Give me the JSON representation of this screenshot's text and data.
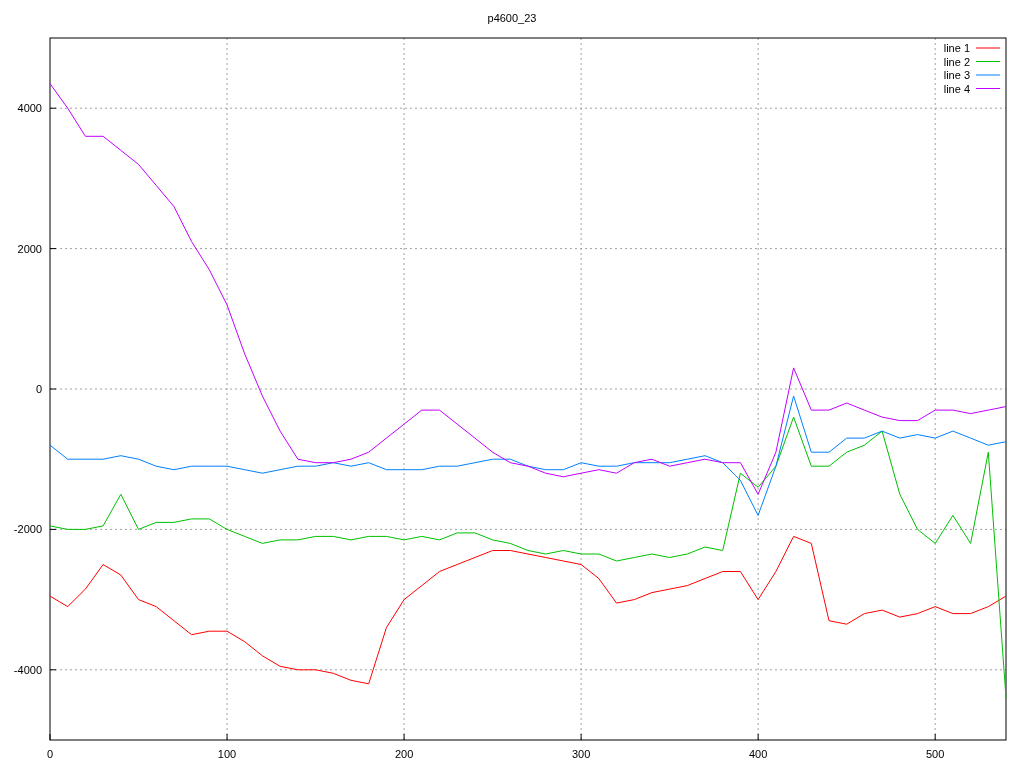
{
  "chart_data": {
    "type": "line",
    "title": "p4600_23",
    "grid": true,
    "legend": true,
    "xlim": [
      0,
      540
    ],
    "ylim": [
      -5000,
      5000
    ],
    "xticks": [
      0,
      100,
      200,
      300,
      400,
      500
    ],
    "yticks": [
      -4000,
      -2000,
      0,
      2000,
      4000
    ],
    "x": [
      0,
      10,
      20,
      30,
      40,
      50,
      60,
      70,
      80,
      90,
      100,
      110,
      120,
      130,
      140,
      150,
      160,
      170,
      180,
      190,
      200,
      210,
      220,
      230,
      240,
      250,
      260,
      270,
      280,
      290,
      300,
      310,
      320,
      330,
      340,
      350,
      360,
      370,
      380,
      390,
      400,
      410,
      420,
      430,
      440,
      450,
      460,
      470,
      480,
      490,
      500,
      510,
      520,
      530,
      540
    ],
    "series": [
      {
        "name": "line 1",
        "color": "#ff0000",
        "values": [
          -2950,
          -3100,
          -2850,
          -2500,
          -2650,
          -3000,
          -3100,
          -3300,
          -3500,
          -3450,
          -3450,
          -3600,
          -3800,
          -3950,
          -4000,
          -4000,
          -4050,
          -4150,
          -4200,
          -3400,
          -3000,
          -2800,
          -2600,
          -2500,
          -2400,
          -2300,
          -2300,
          -2350,
          -2400,
          -2450,
          -2500,
          -2700,
          -3050,
          -3000,
          -2900,
          -2850,
          -2800,
          -2700,
          -2600,
          -2600,
          -3000,
          -2600,
          -2100,
          -2200,
          -3300,
          -3350,
          -3200,
          -3150,
          -3250,
          -3200,
          -3100,
          -3200,
          -3200,
          -3100,
          -2950
        ]
      },
      {
        "name": "line 2",
        "color": "#00c000",
        "values": [
          -1950,
          -2000,
          -2000,
          -1950,
          -1500,
          -2000,
          -1900,
          -1900,
          -1850,
          -1850,
          -2000,
          -2100,
          -2200,
          -2150,
          -2150,
          -2100,
          -2100,
          -2150,
          -2100,
          -2100,
          -2150,
          -2100,
          -2150,
          -2050,
          -2050,
          -2150,
          -2200,
          -2300,
          -2350,
          -2300,
          -2350,
          -2350,
          -2450,
          -2400,
          -2350,
          -2400,
          -2350,
          -2250,
          -2300,
          -1200,
          -1400,
          -1100,
          -400,
          -1100,
          -1100,
          -900,
          -800,
          -600,
          -1500,
          -2000,
          -2200,
          -1800,
          -2200,
          -900,
          -4400
        ]
      },
      {
        "name": "line 3",
        "color": "#0080ff",
        "values": [
          -800,
          -1000,
          -1000,
          -1000,
          -950,
          -1000,
          -1100,
          -1150,
          -1100,
          -1100,
          -1100,
          -1150,
          -1200,
          -1150,
          -1100,
          -1100,
          -1050,
          -1100,
          -1050,
          -1150,
          -1150,
          -1150,
          -1100,
          -1100,
          -1050,
          -1000,
          -1000,
          -1100,
          -1150,
          -1150,
          -1050,
          -1100,
          -1100,
          -1050,
          -1050,
          -1050,
          -1000,
          -950,
          -1050,
          -1300,
          -1800,
          -1100,
          -100,
          -900,
          -900,
          -700,
          -700,
          -600,
          -700,
          -650,
          -700,
          -600,
          -700,
          -800,
          -750
        ]
      },
      {
        "name": "line 4",
        "color": "#c000ff",
        "values": [
          4350,
          4000,
          3600,
          3600,
          3400,
          3200,
          2900,
          2600,
          2100,
          1700,
          1200,
          500,
          -100,
          -600,
          -1000,
          -1050,
          -1050,
          -1000,
          -900,
          -700,
          -500,
          -300,
          -300,
          -500,
          -700,
          -900,
          -1050,
          -1100,
          -1200,
          -1250,
          -1200,
          -1150,
          -1200,
          -1050,
          -1000,
          -1100,
          -1050,
          -1000,
          -1050,
          -1050,
          -1500,
          -900,
          300,
          -300,
          -300,
          -200,
          -300,
          -400,
          -450,
          -450,
          -300,
          -300,
          -350,
          -300,
          -250
        ]
      }
    ]
  }
}
